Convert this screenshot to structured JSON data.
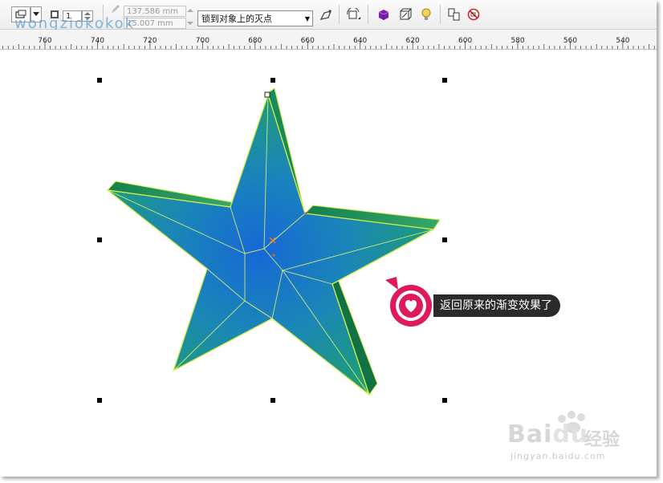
{
  "toolbar": {
    "outline_width": "1",
    "size_a": "137.586 mm",
    "size_b": "15.007 mm",
    "snap_select": "锁到对象上的灭点"
  },
  "watermark": {
    "top_text": "wongziokokok"
  },
  "ruler": {
    "labels": [
      "760",
      "740",
      "720",
      "700",
      "680",
      "660",
      "640",
      "620",
      "600",
      "580",
      "560",
      "540"
    ]
  },
  "callout": {
    "text": "返回原来的渐变效果了"
  },
  "baidu": {
    "logo": "Bai",
    "logo_suffix": "du",
    "cn": "经验",
    "url": "jingyan.baidu.com"
  },
  "colors": {
    "star_fill_center": "#1a6fd0",
    "star_fill_edge": "#1f9e6a",
    "star_outline": "#d8ee4a",
    "callout_accent": "#e0195c",
    "callout_bg": "#2b2b2b"
  }
}
